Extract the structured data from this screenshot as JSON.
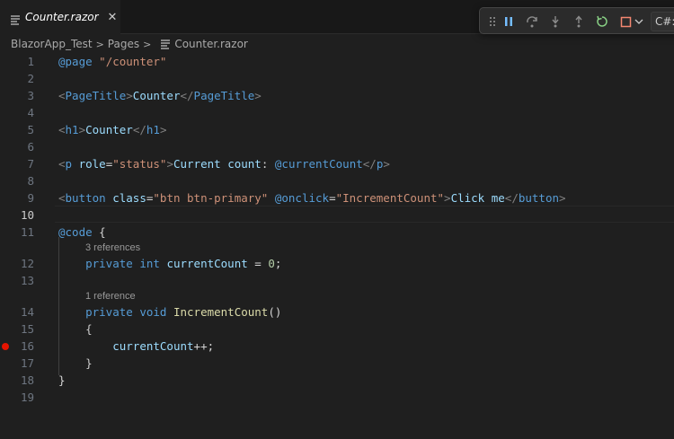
{
  "tab": {
    "filename": "Counter.razor",
    "close_glyph": "✕"
  },
  "debug_toolbar": {
    "icons": [
      "gripper-icon",
      "pause-icon",
      "step-over-icon",
      "step-into-icon",
      "step-out-icon",
      "restart-icon",
      "stop-icon"
    ],
    "language": "C#:"
  },
  "breadcrumb": {
    "project": "BlazorApp_Test",
    "folder": "Pages",
    "file": "Counter.razor"
  },
  "editor": {
    "active_line": 10,
    "breakpoint_line": 16,
    "codelens": [
      "3 references",
      "1 reference"
    ],
    "line_numbers": [
      "1",
      "2",
      "3",
      "4",
      "5",
      "6",
      "7",
      "8",
      "9",
      "10",
      "11",
      "12",
      "13",
      "14",
      "15",
      "16",
      "17",
      "18",
      "19"
    ],
    "code_lines": [
      "@page \"/counter\"",
      "",
      "<PageTitle>Counter</PageTitle>",
      "",
      "<h1>Counter</h1>",
      "",
      "<p role=\"status\">Current count: @currentCount</p>",
      "",
      "<button class=\"btn btn-primary\" @onclick=\"IncrementCount\">Click me</button>",
      "",
      "@code {",
      "    private int currentCount = 0;",
      "",
      "    private void IncrementCount()",
      "    {",
      "        currentCount++;",
      "    }",
      "}",
      ""
    ]
  },
  "colors": {
    "background": "#1f1f1f",
    "keyword": "#569cd6",
    "string": "#ce9178",
    "attribute": "#9cdcfe",
    "function": "#dcdcaa",
    "number": "#b5cea8",
    "breakpoint": "#e51400",
    "debug_accent": "#75beff"
  }
}
